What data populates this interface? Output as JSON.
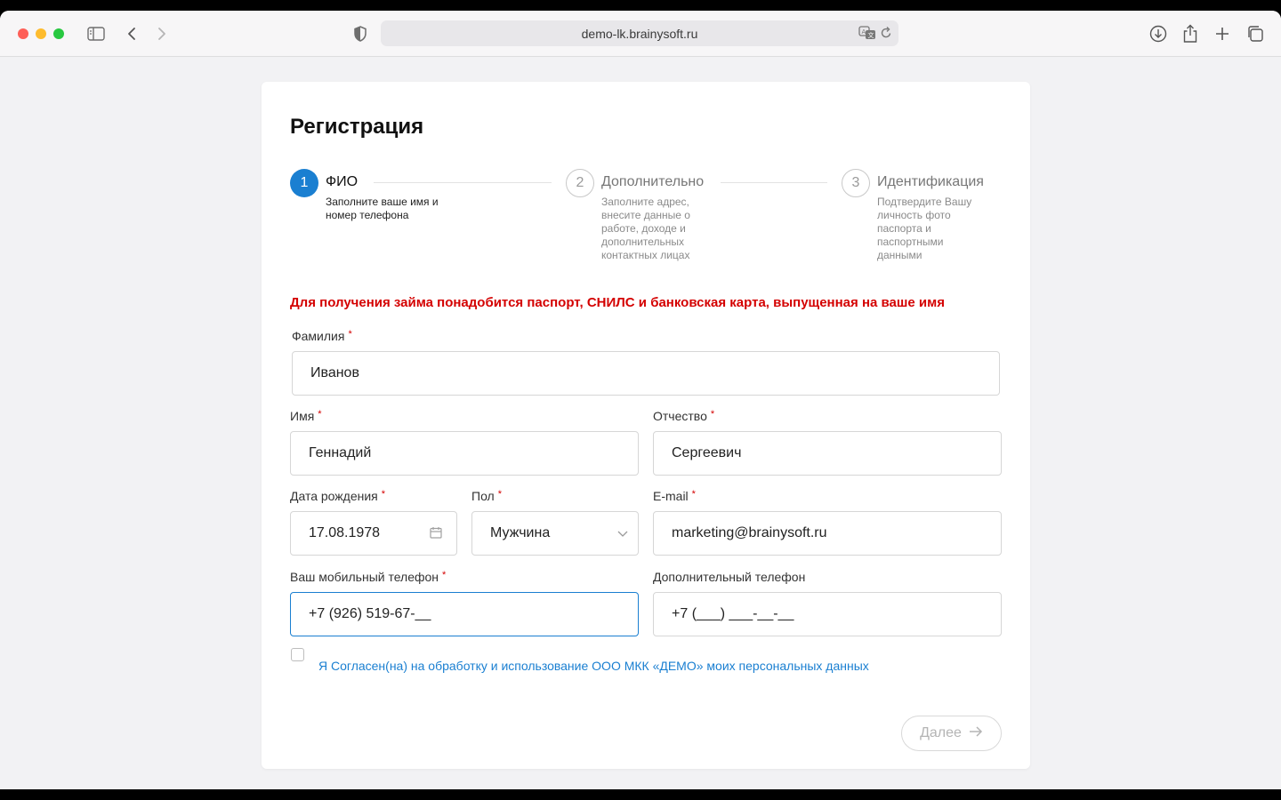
{
  "browser": {
    "url": "demo-lk.brainysoft.ru"
  },
  "page": {
    "title": "Регистрация",
    "warning": "Для получения займа понадобится паспорт, СНИЛС и банковская карта, выпущенная на ваше имя"
  },
  "steps": [
    {
      "number": "1",
      "title": "ФИО",
      "description": "Заполните ваше имя и номер телефона",
      "state": "active"
    },
    {
      "number": "2",
      "title": "Дополнительно",
      "description": "Заполните адрес, внесите данные о работе, доходе и дополнительных контактных лицах",
      "state": "inactive"
    },
    {
      "number": "3",
      "title": "Идентификация",
      "description": "Подтвердите Вашу личность фото паспорта и паспортными данными",
      "state": "inactive"
    }
  ],
  "form": {
    "required_mark": "*",
    "last_name": {
      "label": "Фамилия",
      "value": "Иванов"
    },
    "first_name": {
      "label": "Имя",
      "value": "Геннадий"
    },
    "middle_name": {
      "label": "Отчество",
      "value": "Сергеевич"
    },
    "birth_date": {
      "label": "Дата рождения",
      "value": "17.08.1978",
      "icon": "calendar-icon"
    },
    "gender": {
      "label": "Пол",
      "value": "Мужчина",
      "icon": "chevron-down-icon"
    },
    "email": {
      "label": "E-mail",
      "value": "marketing@brainysoft.ru"
    },
    "phone": {
      "label": "Ваш мобильный телефон",
      "value": "+7 (926) 519-67-__"
    },
    "extra_phone": {
      "label": "Дополнительный телефон",
      "value": "+7 (___) ___-__-__"
    },
    "consent": {
      "label": "Я Согласен(на) на обработку и использование ООО МКК «ДЕМО» моих персональных данных",
      "checked": false
    },
    "next_button": {
      "label": "Далее",
      "icon": "arrow-right-icon"
    }
  },
  "colors": {
    "accent": "#1a7fd1",
    "warning": "#d40000"
  }
}
